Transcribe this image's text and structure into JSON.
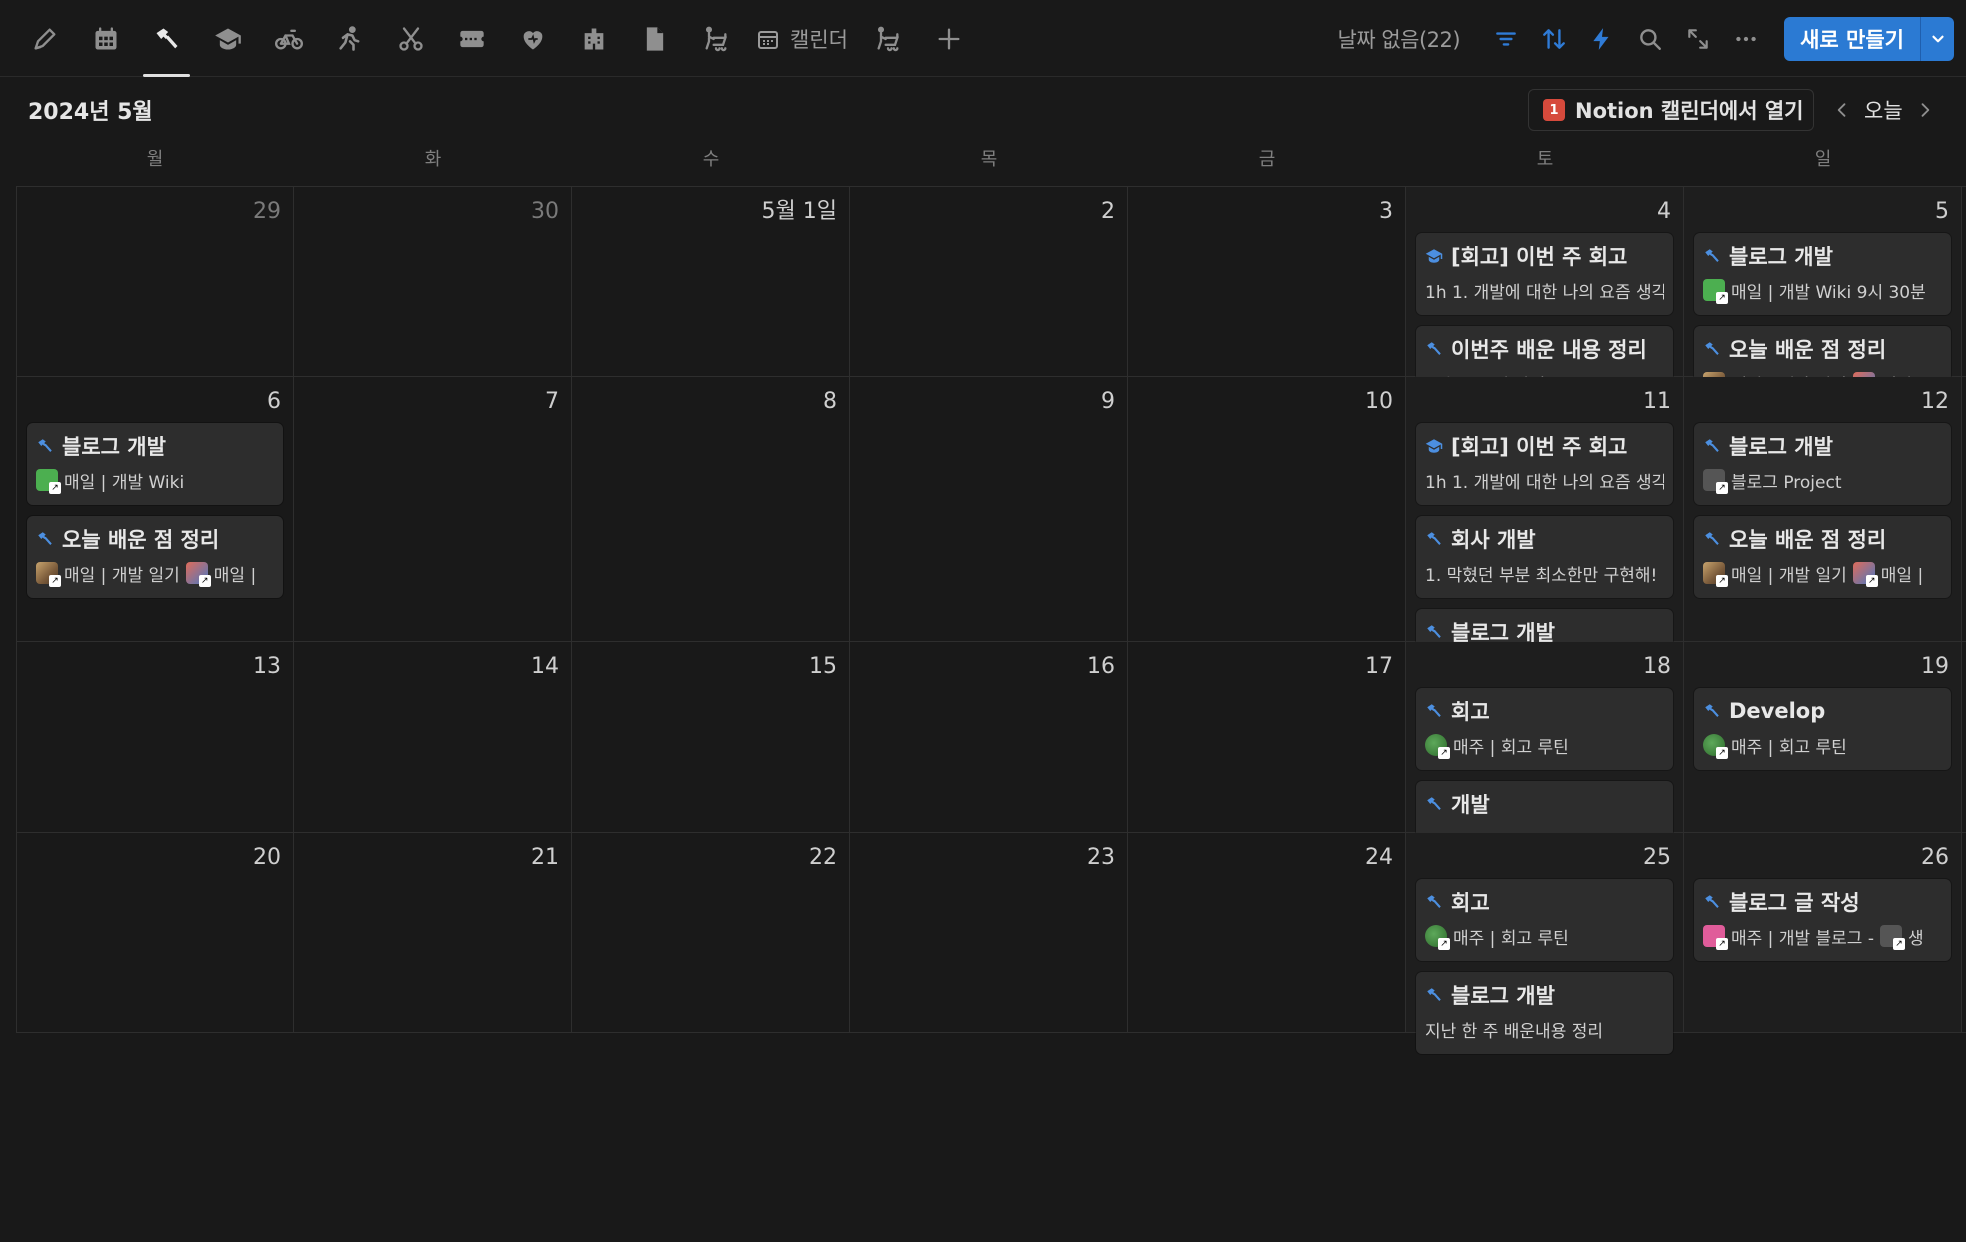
{
  "toolbar": {
    "tabs": [
      {
        "icon": "pencil-icon"
      },
      {
        "icon": "calendar-grid-icon"
      },
      {
        "icon": "hammer-icon",
        "active": true
      },
      {
        "icon": "graduation-cap-icon"
      },
      {
        "icon": "bicycle-icon"
      },
      {
        "icon": "running-person-icon"
      },
      {
        "icon": "scissors-icon"
      },
      {
        "icon": "ticket-icon"
      },
      {
        "icon": "heart-icon"
      },
      {
        "icon": "building-icon"
      },
      {
        "icon": "document-icon"
      },
      {
        "icon": "stroller-icon"
      }
    ],
    "calendar_tab_label": "캘린더",
    "no_date_label": "날짜 없음(22)",
    "new_button_label": "새로 만들기"
  },
  "header": {
    "month_title": "2024년 5월",
    "open_in_calendar_label": "Notion 캘린더에서 열기",
    "calendar_badge": "1",
    "today_label": "오늘"
  },
  "weekdays": [
    "월",
    "화",
    "수",
    "목",
    "금",
    "토",
    "일"
  ],
  "weeks": [
    {
      "height": 190,
      "days": [
        {
          "num": "29",
          "muted": true,
          "events": []
        },
        {
          "num": "30",
          "muted": true,
          "events": []
        },
        {
          "num": "5월 1일",
          "events": []
        },
        {
          "num": "2",
          "events": []
        },
        {
          "num": "3",
          "events": []
        },
        {
          "num": "4",
          "weekend": true,
          "events": [
            {
              "icon": "cap",
              "title": "[회고] 이번 주 회고",
              "sub": "1h 1. 개발에 대한 나의 요즘 생각"
            },
            {
              "icon": "hammer",
              "title": "이번주 배운 내용 정리",
              "sub": "복습 시스템 작성"
            }
          ]
        },
        {
          "num": "5",
          "weekend": true,
          "events": [
            {
              "icon": "hammer",
              "title": "블로그 개발",
              "thumb": "green",
              "sub": "매일 | 개발 Wiki 9시 30분"
            },
            {
              "icon": "hammer",
              "title": "오늘 배운 점 정리",
              "thumb": "photo",
              "sub": "매일 | 개발 일기",
              "thumb2": "desk",
              "sub2": "매일 |"
            }
          ]
        }
      ]
    },
    {
      "height": 265,
      "days": [
        {
          "num": "6",
          "events": [
            {
              "icon": "hammer",
              "title": "블로그 개발",
              "thumb": "green",
              "sub": "매일 | 개발 Wiki"
            },
            {
              "icon": "hammer",
              "title": "오늘 배운 점 정리",
              "thumb": "photo",
              "sub": "매일 | 개발 일기",
              "thumb2": "desk",
              "sub2": "매일 |"
            }
          ]
        },
        {
          "num": "7",
          "events": []
        },
        {
          "num": "8",
          "events": []
        },
        {
          "num": "9",
          "events": []
        },
        {
          "num": "10",
          "events": []
        },
        {
          "num": "11",
          "weekend": true,
          "events": [
            {
              "icon": "cap",
              "title": "[회고] 이번 주 회고",
              "sub": "1h 1. 개발에 대한 나의 요즘 생각"
            },
            {
              "icon": "hammer",
              "title": "회사 개발",
              "sub": "1. 막혔던 부분 최소한만 구현해!"
            },
            {
              "icon": "hammer",
              "title": "블로그 개발",
              "sub": ""
            }
          ]
        },
        {
          "num": "12",
          "weekend": true,
          "events": [
            {
              "icon": "hammer",
              "title": "블로그 개발",
              "thumb": "grey",
              "sub": "블로그 Project"
            },
            {
              "icon": "hammer",
              "title": "오늘 배운 점 정리",
              "thumb": "photo",
              "sub": "매일 | 개발 일기",
              "thumb2": "desk",
              "sub2": "매일 |"
            }
          ]
        }
      ]
    },
    {
      "height": 191,
      "days": [
        {
          "num": "13",
          "events": []
        },
        {
          "num": "14",
          "events": []
        },
        {
          "num": "15",
          "events": []
        },
        {
          "num": "16",
          "events": []
        },
        {
          "num": "17",
          "events": []
        },
        {
          "num": "18",
          "weekend": true,
          "events": [
            {
              "icon": "hammer",
              "title": "회고",
              "thumb": "lottie",
              "sub": "매주 | 회고 루틴"
            },
            {
              "icon": "hammer",
              "title": "개발",
              "sub": ""
            }
          ]
        },
        {
          "num": "19",
          "weekend": true,
          "events": [
            {
              "icon": "hammer",
              "title": "Develop",
              "thumb": "lottie",
              "sub": "매주 | 회고 루틴"
            }
          ]
        }
      ]
    },
    {
      "height": 200,
      "days": [
        {
          "num": "20",
          "events": []
        },
        {
          "num": "21",
          "events": []
        },
        {
          "num": "22",
          "events": []
        },
        {
          "num": "23",
          "events": []
        },
        {
          "num": "24",
          "events": []
        },
        {
          "num": "25",
          "weekend": true,
          "events": [
            {
              "icon": "hammer",
              "title": "회고",
              "thumb": "lottie",
              "sub": "매주 | 회고 루틴"
            },
            {
              "icon": "hammer",
              "title": "블로그 개발",
              "sub": "지난 한 주 배운내용 정리"
            }
          ]
        },
        {
          "num": "26",
          "weekend": true,
          "events": [
            {
              "icon": "hammer",
              "title": "블로그 글 작성",
              "thumb": "pink",
              "sub": "매주 | 개발 블로그 -",
              "thumb2": "grey",
              "sub2": "생"
            }
          ]
        }
      ]
    }
  ],
  "colors": {
    "accent": "#2b7ad3",
    "background": "#191919",
    "card": "#2d2d2d"
  }
}
